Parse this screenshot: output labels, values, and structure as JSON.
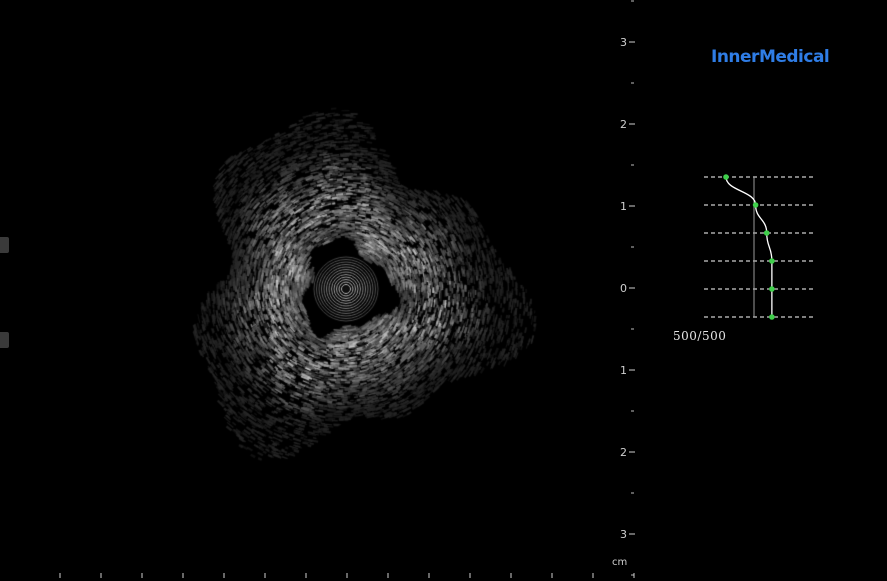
{
  "brand": {
    "name": "InnerMedical"
  },
  "scale": {
    "vertical_labels": [
      "3",
      "2",
      "1",
      "0",
      "1",
      "2",
      "3"
    ],
    "unit": "cm"
  },
  "tgc_curve": {
    "frame_counter": "500/500",
    "point_levels": [
      0.0,
      0.4,
      0.55,
      0.62,
      0.62,
      0.62
    ],
    "colors": {
      "point": "#3ecf4a",
      "line": "#ffffff",
      "guide": "#ffffff"
    }
  },
  "side_tabs": [
    "side-tab-upper",
    "side-tab-lower"
  ]
}
